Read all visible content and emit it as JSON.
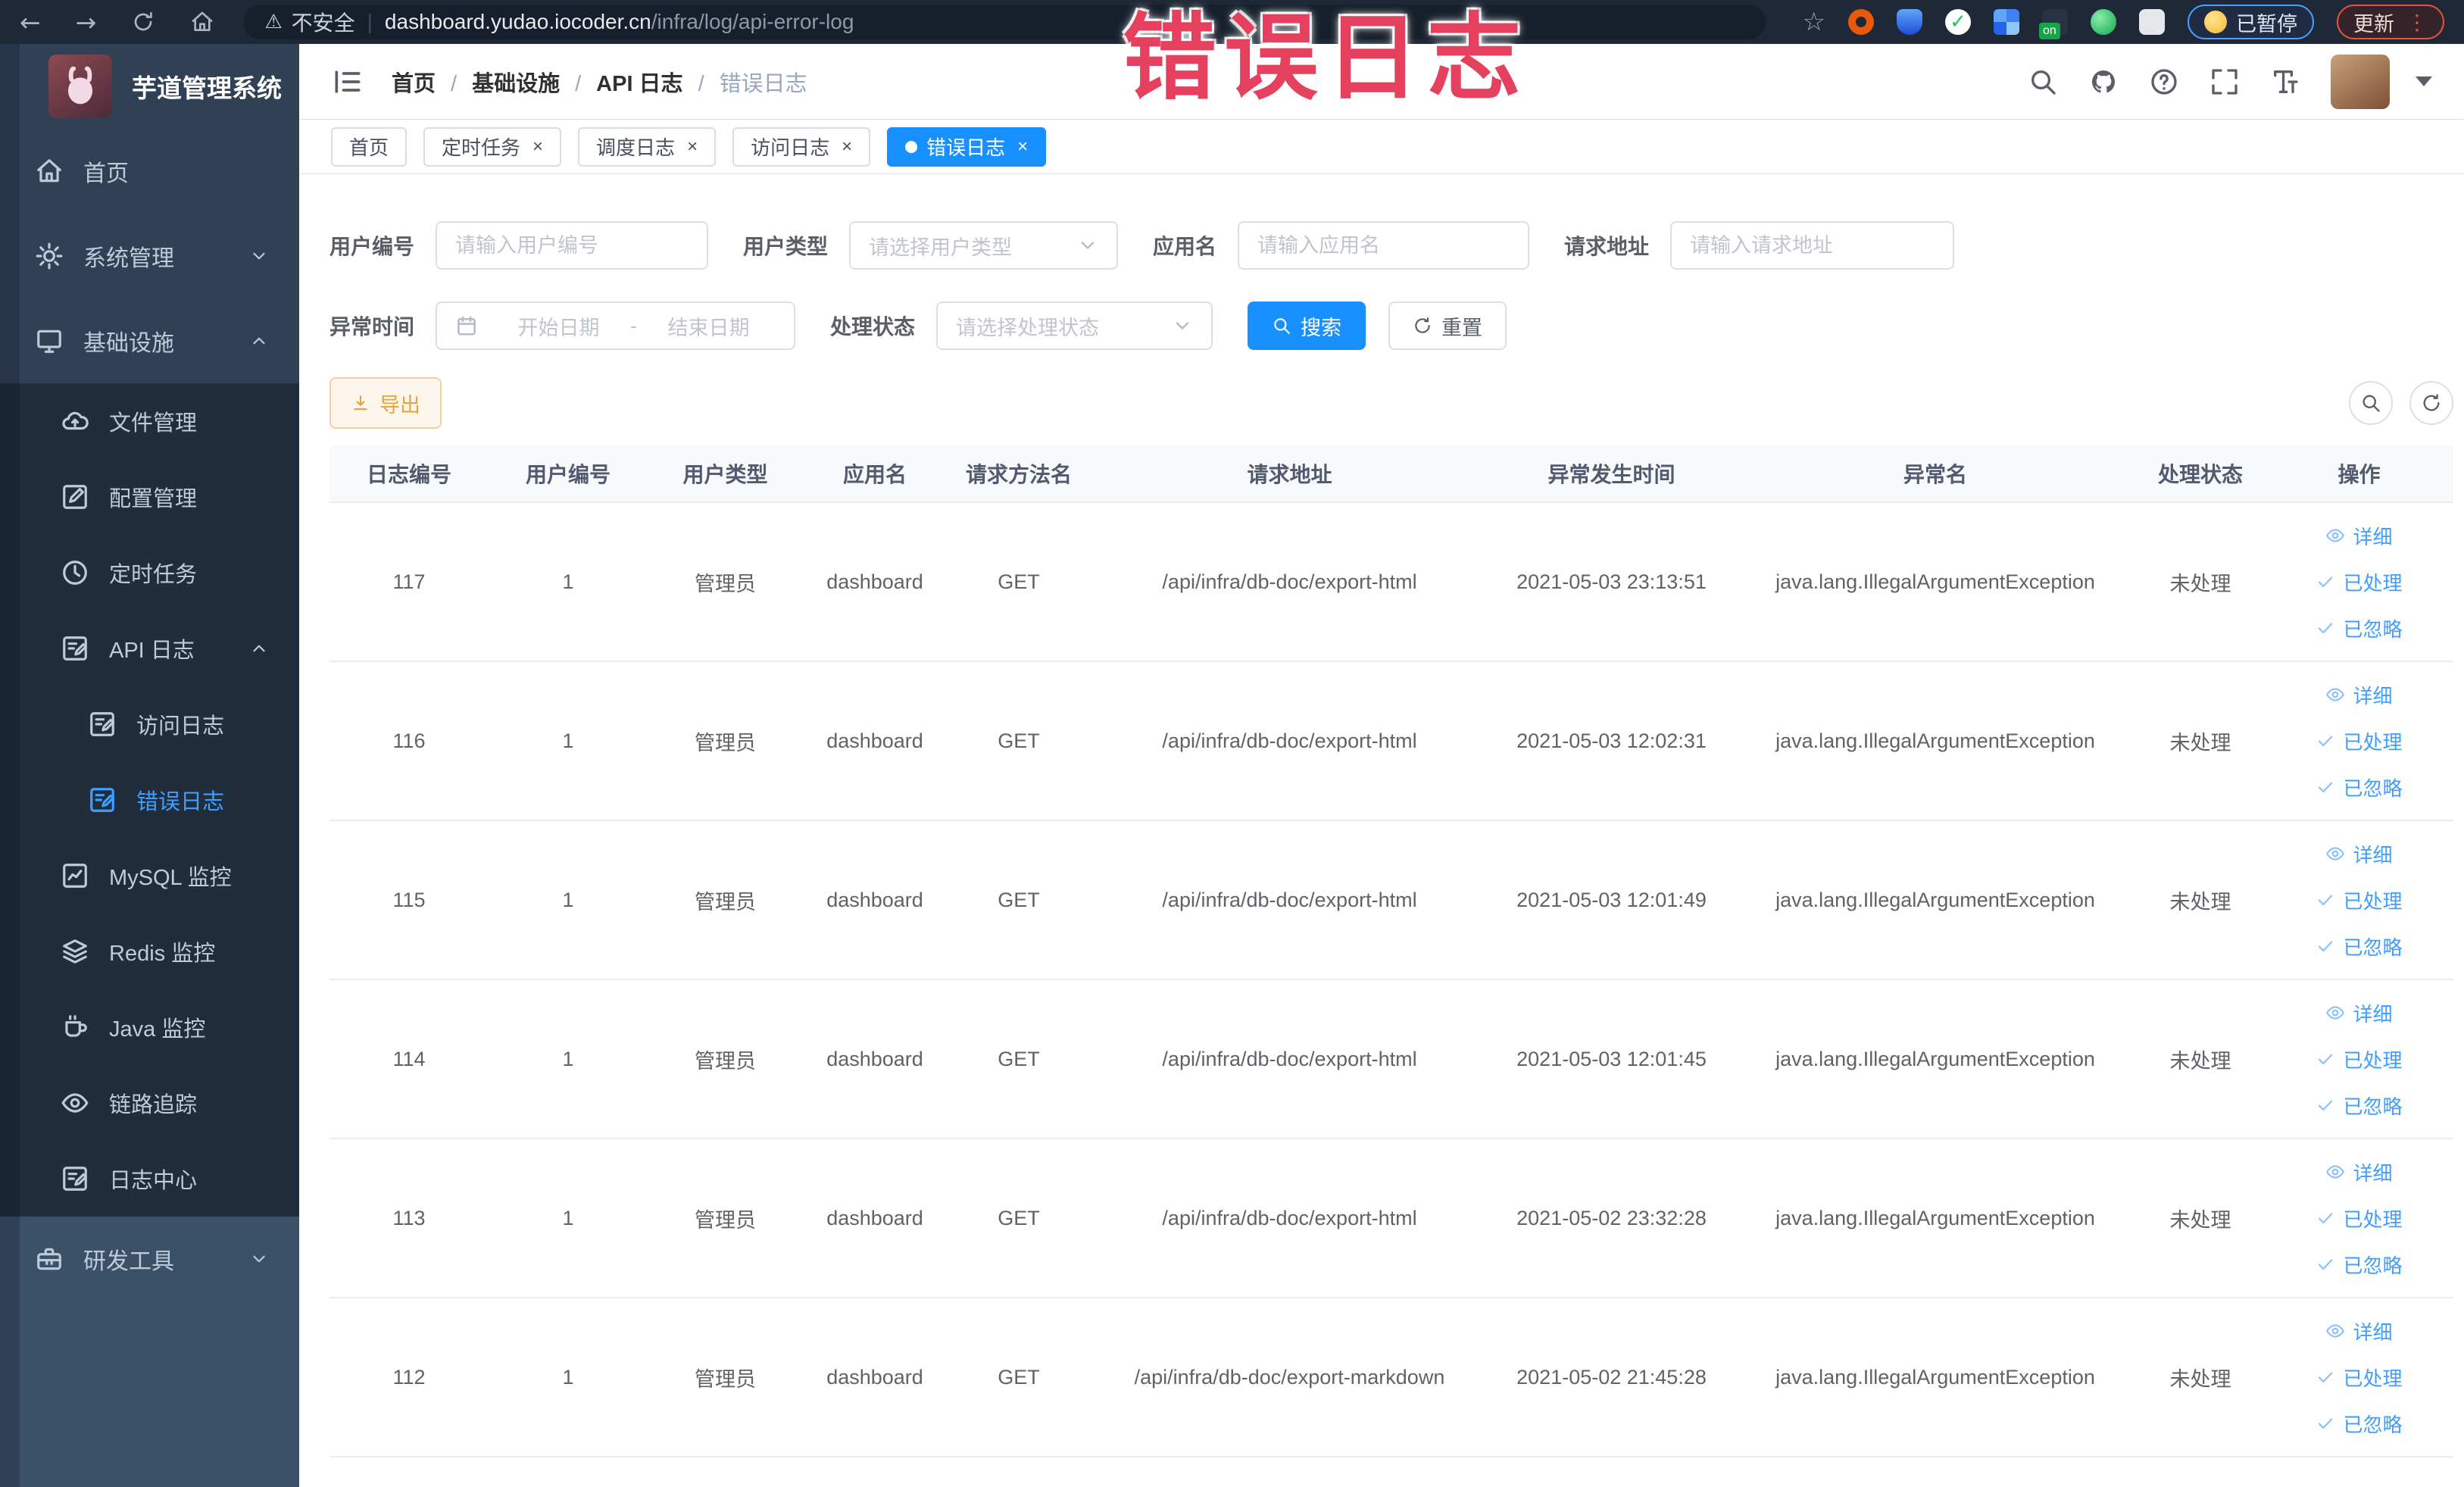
{
  "theme": {
    "primary": "#1890ff",
    "link": "#409eff",
    "warning": "#e6a23c",
    "overlay_red": "#e5405e",
    "sidebar_bg": "#304156",
    "submenu_bg": "#1f2d3d"
  },
  "overlay_text": "错误日志",
  "browser": {
    "security_label": "不安全",
    "url_domain": "dashboard.yudao.iocoder.cn",
    "url_path": "/infra/log/api-error-log",
    "url_separator": "|",
    "paused_badge": "已暂停",
    "update_badge": "更新"
  },
  "sidebar": {
    "logo_title": "芋道管理系统",
    "top_items": [
      {
        "label": "首页",
        "icon": "home",
        "level": "lv0"
      },
      {
        "label": "系统管理",
        "icon": "gear",
        "level": "lv0",
        "chevron": "down"
      },
      {
        "label": "基础设施",
        "icon": "monitor",
        "level": "lv0",
        "chevron": "up"
      }
    ],
    "sub_items": [
      {
        "label": "文件管理",
        "icon": "cloud",
        "level": "lv1"
      },
      {
        "label": "配置管理",
        "icon": "edit",
        "level": "lv1"
      },
      {
        "label": "定时任务",
        "icon": "clock",
        "level": "lv1"
      },
      {
        "label": "API 日志",
        "icon": "doc",
        "level": "lv1",
        "chevron": "up"
      },
      {
        "label": "访问日志",
        "icon": "doc",
        "level": "lv2"
      },
      {
        "label": "错误日志",
        "icon": "doc",
        "level": "lv2",
        "active": true
      },
      {
        "label": "MySQL 监控",
        "icon": "chart",
        "level": "lv1"
      },
      {
        "label": "Redis 监控",
        "icon": "layers",
        "level": "lv1"
      },
      {
        "label": "Java 监控",
        "icon": "cup",
        "level": "lv1"
      },
      {
        "label": "链路追踪",
        "icon": "eye",
        "level": "lv1"
      },
      {
        "label": "日志中心",
        "icon": "doc",
        "level": "lv1"
      }
    ],
    "bottom_items": [
      {
        "label": "研发工具",
        "icon": "toolbox",
        "level": "lv0",
        "chevron": "down"
      }
    ]
  },
  "breadcrumb": [
    "首页",
    "基础设施",
    "API 日志",
    "错误日志"
  ],
  "tabs": [
    {
      "label": "首页"
    },
    {
      "label": "定时任务",
      "closable": true
    },
    {
      "label": "调度日志",
      "closable": true
    },
    {
      "label": "访问日志",
      "closable": true
    },
    {
      "label": "错误日志",
      "closable": true,
      "active": true
    }
  ],
  "filters": {
    "user_id": {
      "label": "用户编号",
      "placeholder": "请输入用户编号"
    },
    "user_type": {
      "label": "用户类型",
      "placeholder": "请选择用户类型"
    },
    "app_name": {
      "label": "应用名",
      "placeholder": "请输入应用名"
    },
    "request_url": {
      "label": "请求地址",
      "placeholder": "请输入请求地址"
    },
    "exception_time": {
      "label": "异常时间",
      "start_placeholder": "开始日期",
      "separator": "-",
      "end_placeholder": "结束日期"
    },
    "handle_status": {
      "label": "处理状态",
      "placeholder": "请选择处理状态"
    },
    "search_label": "搜索",
    "reset_label": "重置"
  },
  "toolbar": {
    "export_label": "导出"
  },
  "table": {
    "columns": [
      "日志编号",
      "用户编号",
      "用户类型",
      "应用名",
      "请求方法名",
      "请求地址",
      "异常发生时间",
      "异常名",
      "处理状态",
      "操作"
    ],
    "actions": [
      {
        "label": "详细",
        "icon": "eye"
      },
      {
        "label": "已处理",
        "icon": "check"
      },
      {
        "label": "已忽略",
        "icon": "check"
      }
    ],
    "rows": [
      {
        "id": "117",
        "user_id": "1",
        "user_type": "管理员",
        "app": "dashboard",
        "method": "GET",
        "url": "/api/infra/db-doc/export-html",
        "time": "2021-05-03 23:13:51",
        "exception": "java.lang.IllegalArgumentException",
        "status": "未处理"
      },
      {
        "id": "116",
        "user_id": "1",
        "user_type": "管理员",
        "app": "dashboard",
        "method": "GET",
        "url": "/api/infra/db-doc/export-html",
        "time": "2021-05-03 12:02:31",
        "exception": "java.lang.IllegalArgumentException",
        "status": "未处理"
      },
      {
        "id": "115",
        "user_id": "1",
        "user_type": "管理员",
        "app": "dashboard",
        "method": "GET",
        "url": "/api/infra/db-doc/export-html",
        "time": "2021-05-03 12:01:49",
        "exception": "java.lang.IllegalArgumentException",
        "status": "未处理"
      },
      {
        "id": "114",
        "user_id": "1",
        "user_type": "管理员",
        "app": "dashboard",
        "method": "GET",
        "url": "/api/infra/db-doc/export-html",
        "time": "2021-05-03 12:01:45",
        "exception": "java.lang.IllegalArgumentException",
        "status": "未处理"
      },
      {
        "id": "113",
        "user_id": "1",
        "user_type": "管理员",
        "app": "dashboard",
        "method": "GET",
        "url": "/api/infra/db-doc/export-html",
        "time": "2021-05-02 23:32:28",
        "exception": "java.lang.IllegalArgumentException",
        "status": "未处理"
      },
      {
        "id": "112",
        "user_id": "1",
        "user_type": "管理员",
        "app": "dashboard",
        "method": "GET",
        "url": "/api/infra/db-doc/export-markdown",
        "time": "2021-05-02 21:45:28",
        "exception": "java.lang.IllegalArgumentException",
        "status": "未处理"
      }
    ]
  }
}
